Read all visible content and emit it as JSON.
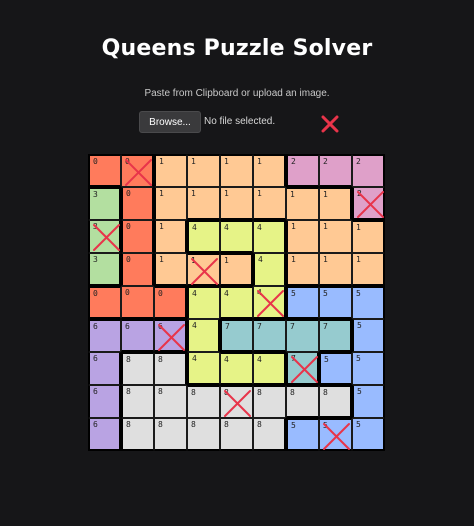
{
  "app": {
    "title": "Queens Puzzle Solver",
    "subtitle": "Paste from Clipboard or upload an image."
  },
  "upload": {
    "browse_label": "Browse...",
    "file_status": "No file selected."
  },
  "colors": {
    "0": "#ff7b5c",
    "1": "#ffc994",
    "2": "#dfa0c9",
    "3": "#b3dfa0",
    "4": "#e6f387",
    "5": "#99bbff",
    "6": "#b9a3e3",
    "7": "#96cbcf",
    "8": "#dfdfdf",
    "accent": "#e8344a"
  },
  "grid": {
    "regions": [
      [
        0,
        0,
        1,
        1,
        1,
        1,
        2,
        2,
        2
      ],
      [
        3,
        0,
        1,
        1,
        1,
        1,
        1,
        1,
        2
      ],
      [
        3,
        0,
        1,
        4,
        4,
        4,
        1,
        1,
        1
      ],
      [
        3,
        0,
        1,
        1,
        1,
        4,
        1,
        1,
        1
      ],
      [
        0,
        0,
        0,
        4,
        4,
        4,
        5,
        5,
        5
      ],
      [
        6,
        6,
        6,
        4,
        7,
        7,
        7,
        7,
        5
      ],
      [
        6,
        8,
        8,
        4,
        4,
        4,
        7,
        5,
        5
      ],
      [
        6,
        8,
        8,
        8,
        8,
        8,
        8,
        8,
        5
      ],
      [
        6,
        8,
        8,
        8,
        8,
        8,
        5,
        5,
        5
      ]
    ],
    "marks": [
      [
        0,
        1
      ],
      [
        1,
        8
      ],
      [
        2,
        0
      ],
      [
        3,
        3
      ],
      [
        4,
        5
      ],
      [
        5,
        2
      ],
      [
        6,
        6
      ],
      [
        7,
        4
      ],
      [
        8,
        7
      ]
    ]
  }
}
